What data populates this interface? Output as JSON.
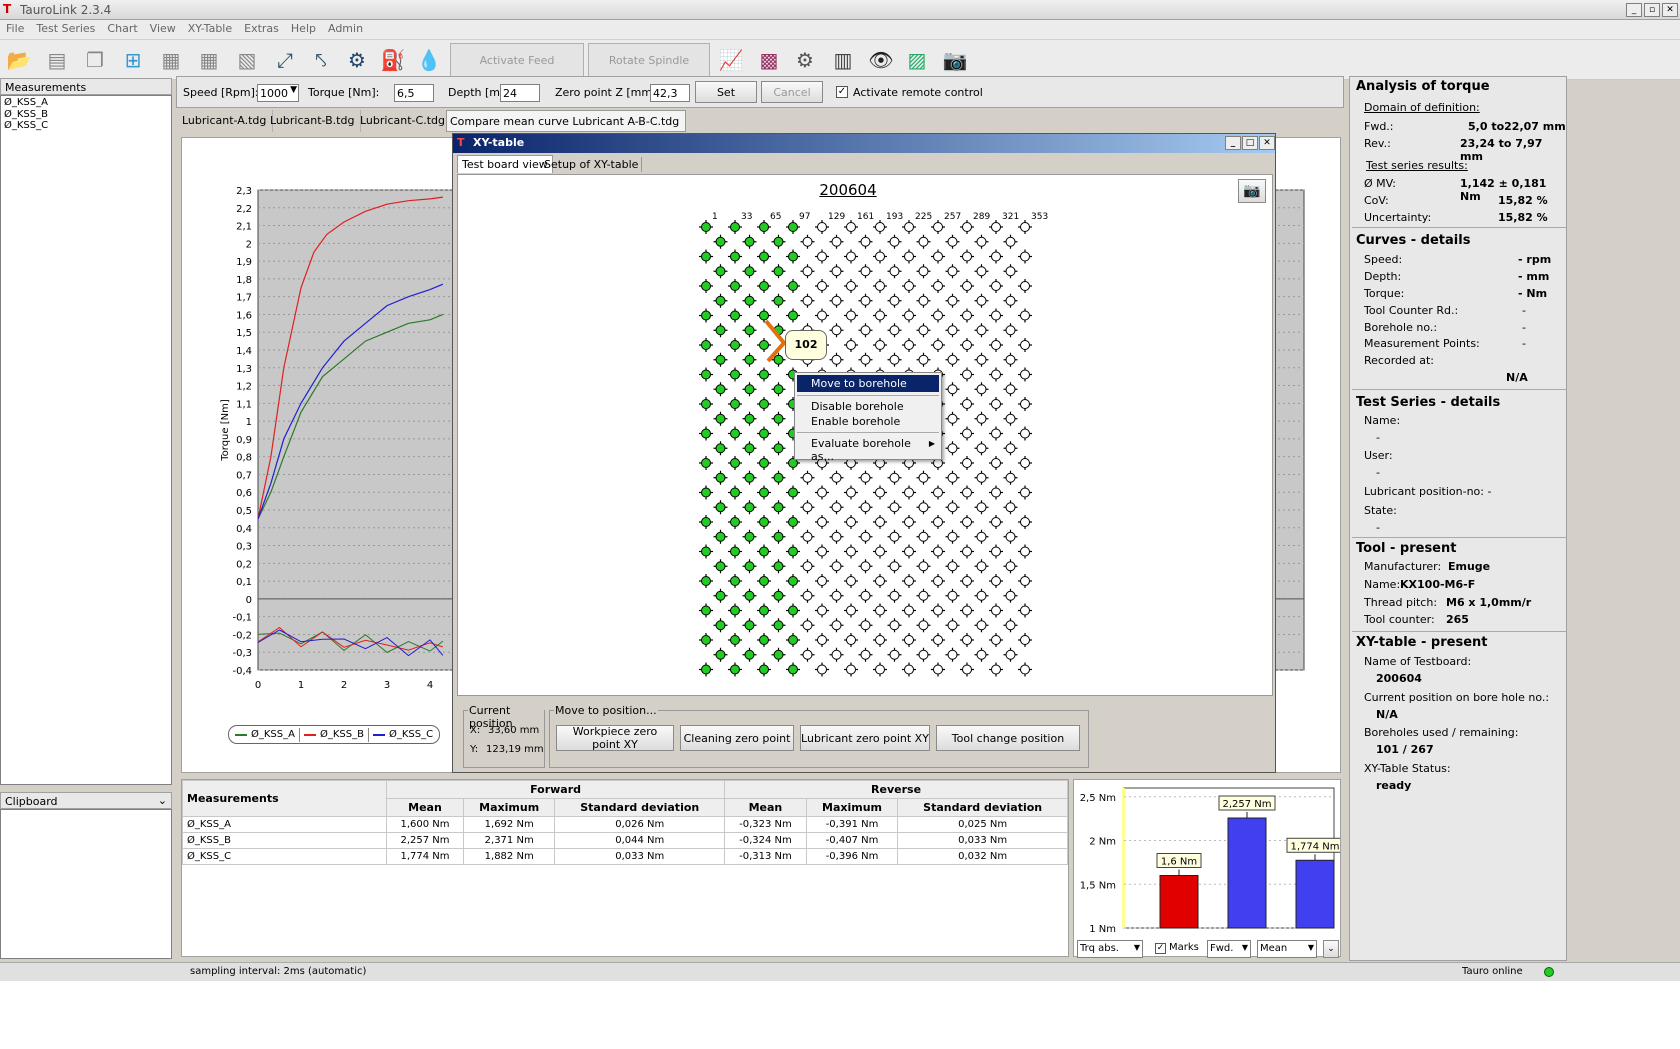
{
  "app": {
    "title": "TauroLink 2.3.4"
  },
  "menu": [
    "File",
    "Test Series",
    "Chart",
    "View",
    "XY-Table",
    "Extras",
    "Help",
    "Admin"
  ],
  "toolbar": {
    "activate_feed": "Activate Feed",
    "rotate_spindle": "Rotate Spindle"
  },
  "left": {
    "measurements_header": "Measurements",
    "items": [
      "Ø_KSS_A",
      "Ø_KSS_B",
      "Ø_KSS_C"
    ],
    "clipboard_header": "Clipboard"
  },
  "params": {
    "speed_label": "Speed [Rpm]:",
    "speed_value": "1000",
    "torque_label": "Torque [Nm]:",
    "torque_value": "6,5",
    "depth_label": "Depth [mm]",
    "depth_value": "24",
    "zero_label": "Zero point Z [mm]:",
    "zero_value": "42,3",
    "set": "Set",
    "cancel": "Cancel",
    "remote": "Activate remote control"
  },
  "tabs": [
    "Lubricant-A.tdg",
    "Lubricant-B.tdg",
    "Lubricant-C.tdg",
    "Compare mean curve Lubricant A-B-C.tdg"
  ],
  "chart_data": {
    "type": "line",
    "ylabel": "Torque [Nm]",
    "xlabel": "",
    "x_ticks": [
      "0",
      "1",
      "2",
      "3",
      "4"
    ],
    "y_ticks": [
      "2,3",
      "2,2",
      "2,1",
      "2",
      "1,9",
      "1,8",
      "1,7",
      "1,6",
      "1,5",
      "1,4",
      "1,3",
      "1,2",
      "1,1",
      "1",
      "0,9",
      "0,8",
      "0,7",
      "0,6",
      "0,5",
      "0,4",
      "0,3",
      "0,2",
      "0,1",
      "0",
      "-0,1",
      "-0,2",
      "-0,3",
      "-0,4"
    ],
    "ylim": [
      -0.4,
      2.3
    ],
    "series": [
      {
        "name": "Ø_KSS_A",
        "color": "#2a7a2a",
        "x": [
          0,
          0.3,
          0.6,
          1,
          1.5,
          2,
          2.5,
          3,
          3.5,
          4,
          4.3
        ],
        "y": [
          0.45,
          0.6,
          0.8,
          1.05,
          1.25,
          1.35,
          1.45,
          1.5,
          1.55,
          1.57,
          1.6
        ]
      },
      {
        "name": "Ø_KSS_B",
        "color": "#e02020",
        "x": [
          0,
          0.3,
          0.6,
          1,
          1.3,
          1.6,
          2,
          2.5,
          3,
          3.5,
          4,
          4.3
        ],
        "y": [
          0.45,
          0.8,
          1.3,
          1.75,
          1.95,
          2.05,
          2.12,
          2.18,
          2.22,
          2.24,
          2.25,
          2.26
        ]
      },
      {
        "name": "Ø_KSS_C",
        "color": "#2020d0",
        "x": [
          0,
          0.3,
          0.6,
          1,
          1.5,
          2,
          2.5,
          3,
          3.5,
          4,
          4.3
        ],
        "y": [
          0.45,
          0.65,
          0.9,
          1.1,
          1.3,
          1.45,
          1.55,
          1.65,
          1.7,
          1.74,
          1.77
        ]
      }
    ],
    "legend": [
      "Ø_KSS_A",
      "Ø_KSS_B",
      "Ø_KSS_C"
    ]
  },
  "xy": {
    "title": "XY-table",
    "tab1": "Test board view",
    "tab2": "Setup of XY-table",
    "board": "200604",
    "col_labels": [
      "1",
      "33",
      "65",
      "97",
      "129",
      "161",
      "193",
      "225",
      "257",
      "289",
      "321",
      "353"
    ],
    "callout": "102",
    "menu": {
      "move": "Move to borehole",
      "disable": "Disable borehole",
      "enable": "Enable borehole",
      "evaluate": "Evaluate borehole as..."
    },
    "curpos_label": "Current position",
    "x_label": "X:",
    "x_value": "33,60 mm",
    "y_label": "Y:",
    "y_value": "123,19 mm",
    "move_label": "Move to position...",
    "btn_workpiece": "Workpiece zero point XY",
    "btn_cleaning": "Cleaning zero point",
    "btn_lubricant": "Lubricant zero point XY",
    "btn_toolchange": "Tool change position"
  },
  "table": {
    "col_meas": "Measurements",
    "forward": "Forward",
    "reverse": "Reverse",
    "sub": [
      "Mean",
      "Maximum",
      "Standard deviation",
      "Mean",
      "Maximum",
      "Standard deviation"
    ],
    "rows": [
      [
        "Ø_KSS_A",
        "1,600 Nm",
        "1,692 Nm",
        "0,026 Nm",
        "-0,323 Nm",
        "-0,391 Nm",
        "0,025 Nm"
      ],
      [
        "Ø_KSS_B",
        "2,257 Nm",
        "2,371 Nm",
        "0,044 Nm",
        "-0,324 Nm",
        "-0,407 Nm",
        "0,033 Nm"
      ],
      [
        "Ø_KSS_C",
        "1,774 Nm",
        "1,882 Nm",
        "0,033 Nm",
        "-0,313 Nm",
        "-0,396 Nm",
        "0,032 Nm"
      ]
    ]
  },
  "bar": {
    "y_ticks": [
      "2,5 Nm",
      "2 Nm",
      "1,5 Nm",
      "1 Nm"
    ],
    "bars": [
      {
        "label": "1,6 Nm",
        "value": 1.6,
        "color": "#e00000"
      },
      {
        "label": "2,257 Nm",
        "value": 2.257,
        "color": "#4040f0"
      },
      {
        "label": "1,774 Nm",
        "value": 1.774,
        "color": "#4040f0"
      }
    ],
    "sel1": "Trq abs.",
    "marks": "Marks",
    "sel2": "Fwd.",
    "sel3": "Mean"
  },
  "right": {
    "analysis": "Analysis of torque",
    "domain": "Domain of definition:",
    "fwd_label": "Fwd.:",
    "fwd_value": "5,0 to22,07   mm",
    "rev_label": "Rev.:",
    "rev_value": "23,24 to 7,97   mm",
    "results": "Test series results:",
    "mv_label": "Ø MV:",
    "mv_value": "1,142 ± 0,181   Nm",
    "cov_label": "CoV:",
    "cov_value": "15,82   %",
    "unc_label": "Uncertainty:",
    "unc_value": "15,82   %",
    "curves": "Curves - details",
    "speed": "Speed:",
    "speed_v": "-   rpm",
    "depth": "Depth:",
    "depth_v": "-   mm",
    "torque": "Torque:",
    "torque_v": "-   Nm",
    "tcr": "Tool Counter Rd.:",
    "tcr_v": "-",
    "bore": "Borehole no.:",
    "bore_v": "-",
    "mp": "Measurement Points:",
    "mp_v": "-",
    "rec": "Recorded at:",
    "rec_v": "N/A",
    "series": "Test Series - details",
    "name": "Name:",
    "name_v": "-",
    "user": "User:",
    "user_v": "-",
    "lub": "Lubricant position-no:  -",
    "state": "State:",
    "state_v": "-",
    "tool": "Tool - present",
    "manu": "Manufacturer:",
    "manu_v": "Emuge",
    "tname": "Name:",
    "tname_v": "KX100-M6-F",
    "pitch": "Thread pitch:",
    "pitch_v": "M6 x  1,0mm/r",
    "tc": "Tool counter:",
    "tc_v": "265",
    "xyp": "XY-table - present",
    "tb": "Name of Testboard:",
    "tb_v": "200604",
    "cp": "Current position on bore hole no.:",
    "cp_v": "N/A",
    "used": "Boreholes used / remaining:",
    "used_v": "101 / 267",
    "status": "XY-Table Status:",
    "status_v": "ready"
  },
  "statusbar": {
    "text": "sampling interval: 2ms (automatic)",
    "online": "Tauro online"
  }
}
